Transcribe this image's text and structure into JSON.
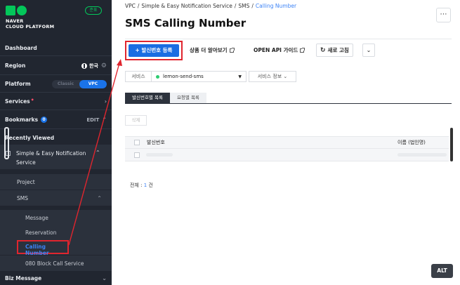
{
  "brand": {
    "logo_line1": "NAVER",
    "logo_line2": "CLOUD PLATFORM",
    "lang_badge": "준표",
    "color": "#03c75a"
  },
  "sidebar": {
    "dashboard": "Dashboard",
    "region": {
      "label": "Region",
      "value": "한국"
    },
    "platform": {
      "label": "Platform",
      "options": [
        "Classic",
        "VPC"
      ],
      "selected": "VPC"
    },
    "services": "Services",
    "bookmarks": {
      "label": "Bookmarks",
      "count": "0",
      "edit": "EDIT"
    },
    "recently_viewed": "Recently Viewed",
    "service": {
      "name": "Simple & Easy Notification Service"
    },
    "items": [
      {
        "label": "Project"
      },
      {
        "label": "SMS"
      }
    ],
    "sms_items": [
      {
        "label": "Message"
      },
      {
        "label": "Reservation"
      },
      {
        "label": "Calling Number"
      },
      {
        "label": "080 Block Call Service"
      }
    ],
    "biz_message": "Biz Message"
  },
  "breadcrumb": {
    "items": [
      "VPC",
      "/",
      "Simple & Easy Notification Service",
      "/",
      "SMS",
      "/"
    ],
    "current": "Calling Number"
  },
  "page": {
    "title": "SMS Calling Number",
    "more": "⋯"
  },
  "toolbar": {
    "register": "+ 발신번호 등록",
    "product_info": "상품 더 알아보기",
    "api_guide": "OPEN API 가이드",
    "refresh": "새로 고침"
  },
  "filter": {
    "label": "서비스",
    "selected": "lemon-send-sms",
    "service_info": "서비스 정보"
  },
  "tabs": [
    {
      "label": "발신번호별 목록"
    },
    {
      "label": "요청별 목록"
    }
  ],
  "actions": {
    "delete": "삭제"
  },
  "table": {
    "columns": [
      "발신번호",
      "이름 (법인명)"
    ]
  },
  "total": {
    "prefix": "전체 :",
    "count": "1",
    "suffix": "건"
  },
  "alt_badge": "ALT",
  "colors": {
    "accent": "#1a6de2",
    "highlight": "#e0252e",
    "sidebar_bg": "#212630"
  }
}
